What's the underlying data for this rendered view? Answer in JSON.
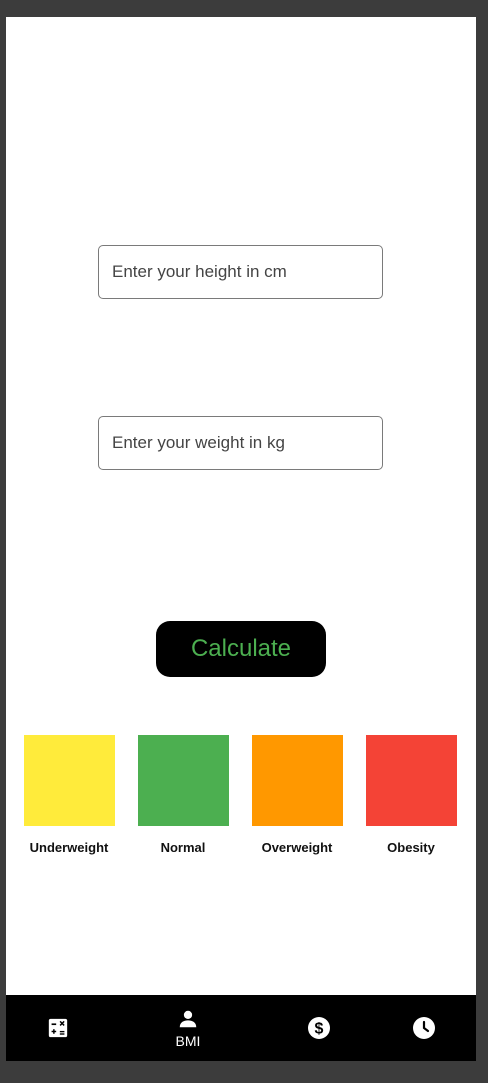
{
  "form": {
    "height_placeholder": "Enter your height in cm",
    "height_value": "",
    "weight_placeholder": "Enter your weight in kg",
    "weight_value": "",
    "calculate_label": "Calculate",
    "calculate_color": "#4caf50"
  },
  "legend": [
    {
      "label": "Underweight",
      "color": "#ffeb3b"
    },
    {
      "label": "Normal",
      "color": "#4caf50"
    },
    {
      "label": "Overweight",
      "color": "#ff9800"
    },
    {
      "label": "Obesity",
      "color": "#f44336"
    }
  ],
  "bottom_nav": {
    "items": [
      {
        "icon": "calculator-icon",
        "label": ""
      },
      {
        "icon": "person-icon",
        "label": "BMI",
        "selected": true
      },
      {
        "icon": "dollar-icon",
        "label": ""
      },
      {
        "icon": "clock-icon",
        "label": ""
      }
    ]
  }
}
